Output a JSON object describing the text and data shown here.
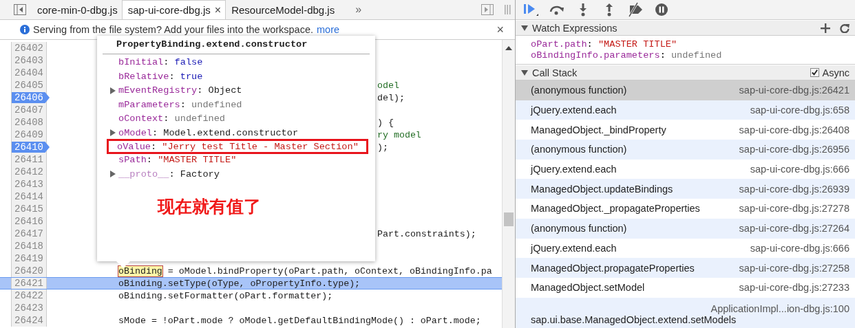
{
  "tabs": [
    {
      "label": "core-min-0-dbg.js",
      "selected": false
    },
    {
      "label": "sap-ui-core-dbg.js",
      "selected": true,
      "close": "×"
    },
    {
      "label": "ResourceModel-dbg.js",
      "selected": false
    }
  ],
  "tab_overflow": "»",
  "infobar": {
    "message": "Serving from the file system? Add your files into the workspace.",
    "link": "more",
    "close": "×"
  },
  "code_lines": [
    {
      "number": "26402",
      "breakpoint": false,
      "current": false,
      "kind": "blank"
    },
    {
      "number": "26403",
      "breakpoint": false,
      "current": false,
      "kind": "blank"
    },
    {
      "number": "26404",
      "breakpoint": false,
      "current": false,
      "kind": "blank"
    },
    {
      "number": "26405",
      "breakpoint": false,
      "current": false,
      "kind": "tail",
      "text": "odel",
      "comment": true
    },
    {
      "number": "26406",
      "breakpoint": true,
      "current": false,
      "kind": "tail",
      "text": "del);",
      "comment": false
    },
    {
      "number": "26407",
      "breakpoint": false,
      "current": false,
      "kind": "blank"
    },
    {
      "number": "26408",
      "breakpoint": false,
      "current": false,
      "kind": "tail",
      "text": ") {",
      "comment": false
    },
    {
      "number": "26409",
      "breakpoint": false,
      "current": false,
      "kind": "tail",
      "text": "ry model",
      "comment": true
    },
    {
      "number": "26410",
      "breakpoint": true,
      "current": false,
      "kind": "tail",
      "text": ");",
      "comment": false
    },
    {
      "number": "26411",
      "breakpoint": false,
      "current": false,
      "kind": "blank"
    },
    {
      "number": "26412",
      "breakpoint": false,
      "current": false,
      "kind": "blank"
    },
    {
      "number": "26413",
      "breakpoint": false,
      "current": false,
      "kind": "blank"
    },
    {
      "number": "26414",
      "breakpoint": false,
      "current": false,
      "kind": "blank"
    },
    {
      "number": "26415",
      "breakpoint": false,
      "current": false,
      "kind": "blank"
    },
    {
      "number": "26416",
      "breakpoint": false,
      "current": false,
      "kind": "blank"
    },
    {
      "number": "26417",
      "breakpoint": false,
      "current": false,
      "kind": "tail",
      "text": "Part.constraints);",
      "comment": false
    },
    {
      "number": "26418",
      "breakpoint": false,
      "current": false,
      "kind": "blank"
    },
    {
      "number": "26419",
      "breakpoint": false,
      "current": false,
      "kind": "blank"
    },
    {
      "number": "26420",
      "breakpoint": false,
      "current": false,
      "kind": "code",
      "highlight": "oBinding",
      "text": " = oModel.bindProperty(oPart.path, oContext, oBindingInfo.pa"
    },
    {
      "number": "26421",
      "breakpoint": false,
      "current": true,
      "kind": "code",
      "text": "oBinding.setType(oType, oPropertyInfo.type);"
    },
    {
      "number": "26422",
      "breakpoint": false,
      "current": false,
      "kind": "code",
      "text": "oBinding.setFormatter(oPart.formatter);"
    },
    {
      "number": "26423",
      "breakpoint": false,
      "current": false,
      "kind": "blank"
    },
    {
      "number": "26424",
      "breakpoint": false,
      "current": false,
      "kind": "code",
      "text": "sMode = !oPart.mode ? oModel.getDefaultBindingMode() : oPart.mode;"
    }
  ],
  "popover": {
    "title": "PropertyBinding.extend.constructor",
    "properties": [
      {
        "name": "bInitial",
        "separator": ":",
        "value": "false",
        "kind": "keyword",
        "expandable": false,
        "marked": false
      },
      {
        "name": "bRelative",
        "separator": ":",
        "value": "true",
        "kind": "keyword",
        "expandable": false,
        "marked": false
      },
      {
        "name": "mEventRegistry",
        "separator": ":",
        "value": "Object",
        "kind": "object",
        "expandable": true,
        "marked": false
      },
      {
        "name": "mParameters",
        "separator": ":",
        "value": "undefined",
        "kind": "undefined",
        "expandable": false,
        "marked": false
      },
      {
        "name": "oContext",
        "separator": ":",
        "value": "undefined",
        "kind": "undefined",
        "expandable": false,
        "marked": false
      },
      {
        "name": "oModel",
        "separator": ":",
        "value": "Model.extend.constructor",
        "kind": "object",
        "expandable": true,
        "marked": false
      },
      {
        "name": "oValue",
        "separator": ":",
        "value": "\"Jerry test Title - Master Section\"",
        "kind": "string",
        "expandable": false,
        "marked": true
      },
      {
        "name": "sPath",
        "separator": ":",
        "value": "\"MASTER TITLE\"",
        "kind": "string",
        "expandable": false,
        "marked": false
      },
      {
        "name": "__proto__",
        "separator": ":",
        "value": "Factory",
        "kind": "object",
        "expandable": true,
        "marked": false
      }
    ],
    "annotation": "现在就有值了"
  },
  "watch": {
    "title": "Watch Expressions",
    "expanded": true,
    "items": [
      {
        "expression": "oPart.path",
        "separator": ":",
        "value": "\"MASTER TITLE\"",
        "kind": "string"
      },
      {
        "expression": "oBindingInfo.parameters",
        "separator": ":",
        "value": "undefined",
        "kind": "undefined"
      }
    ]
  },
  "call_stack": {
    "title": "Call Stack",
    "expanded": true,
    "async_label": "Async",
    "async_checked": true,
    "frames": [
      {
        "name": "(anonymous function)",
        "location": "sap-ui-core-dbg.js:26421",
        "selected": true
      },
      {
        "name": "jQuery.extend.each",
        "location": "sap-ui-core-dbg.js:658",
        "selected": false
      },
      {
        "name": "ManagedObject._bindProperty",
        "location": "sap-ui-core-dbg.js:26408",
        "selected": false
      },
      {
        "name": "(anonymous function)",
        "location": "sap-ui-core-dbg.js:26956",
        "selected": false
      },
      {
        "name": "jQuery.extend.each",
        "location": "sap-ui-core-dbg.js:666",
        "selected": false
      },
      {
        "name": "ManagedObject.updateBindings",
        "location": "sap-ui-core-dbg.js:26939",
        "selected": false
      },
      {
        "name": "ManagedObject._propagateProperties",
        "location": "sap-ui-core-dbg.js:27278",
        "selected": false
      },
      {
        "name": "(anonymous function)",
        "location": "sap-ui-core-dbg.js:27264",
        "selected": false
      },
      {
        "name": "jQuery.extend.each",
        "location": "sap-ui-core-dbg.js:666",
        "selected": false
      },
      {
        "name": "ManagedObject.propagateProperties",
        "location": "sap-ui-core-dbg.js:27258",
        "selected": false
      },
      {
        "name": "ManagedObject.setModel",
        "location": "sap-ui-core-dbg.js:27233",
        "selected": false
      },
      {
        "name": "sap.ui.base.ManagedObject.extend.setModels",
        "location": "ApplicationImpl...ion-dbg.js:100",
        "selected": false,
        "wrapped": true
      }
    ]
  }
}
